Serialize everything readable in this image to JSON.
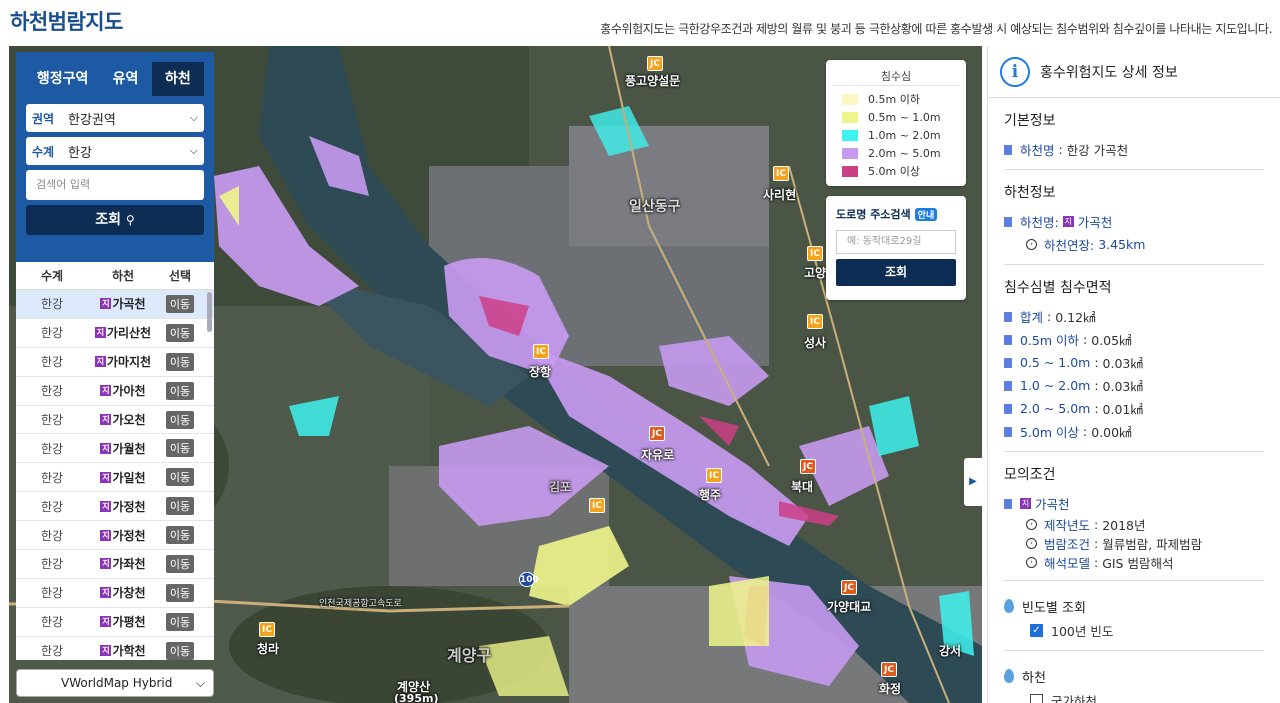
{
  "header": {
    "title": "하천범람지도",
    "description": "홍수위험지도는 극한강우조건과 제방의 월류 및 붕괴 등 극한상황에 따른 홍수발생 시 예상되는 침수범위와 침수깊이를 나타내는 지도입니다."
  },
  "left_panel": {
    "tabs": [
      {
        "label": "행정구역",
        "active": false
      },
      {
        "label": "유역",
        "active": false
      },
      {
        "label": "하천",
        "active": true
      }
    ],
    "basin_label": "권역",
    "basin_value": "한강권역",
    "system_label": "수계",
    "system_value": "한강",
    "search_placeholder": "검색어 입력",
    "query_button": "조회",
    "table_headers": {
      "system": "수계",
      "river": "하천",
      "select": "선택"
    },
    "move_label": "이동",
    "rivers": [
      {
        "system": "한강",
        "name": "가곡천",
        "selected": true
      },
      {
        "system": "한강",
        "name": "가리산천",
        "selected": false
      },
      {
        "system": "한강",
        "name": "가마지천",
        "selected": false
      },
      {
        "system": "한강",
        "name": "가아천",
        "selected": false
      },
      {
        "system": "한강",
        "name": "가오천",
        "selected": false
      },
      {
        "system": "한강",
        "name": "가월천",
        "selected": false
      },
      {
        "system": "한강",
        "name": "가일천",
        "selected": false
      },
      {
        "system": "한강",
        "name": "가정천",
        "selected": false
      },
      {
        "system": "한강",
        "name": "가정천",
        "selected": false
      },
      {
        "system": "한강",
        "name": "가좌천",
        "selected": false
      },
      {
        "system": "한강",
        "name": "가창천",
        "selected": false
      },
      {
        "system": "한강",
        "name": "가평천",
        "selected": false
      },
      {
        "system": "한강",
        "name": "가학천",
        "selected": false
      }
    ],
    "river_badge": "지",
    "basemap": "VWorldMap Hybrid"
  },
  "legend": {
    "title": "침수심",
    "items": [
      {
        "label": "0.5m 이하",
        "color": "#fbf6c2"
      },
      {
        "label": "0.5m ~ 1.0m",
        "color": "#eef58a"
      },
      {
        "label": "1.0m ~ 2.0m",
        "color": "#3ef2ef"
      },
      {
        "label": "2.0m ~ 5.0m",
        "color": "#c79af0"
      },
      {
        "label": "5.0m 이상",
        "color": "#cc3f86"
      }
    ]
  },
  "address_search": {
    "title": "도로명 주소검색",
    "guide": "안내",
    "placeholder": "예: 동작대로29길",
    "button": "조회"
  },
  "map_labels": {
    "goyang_seolmun": "풍고양설문",
    "sarihyeon": "사리현",
    "ilsan": "일산동구",
    "goyang": "고양",
    "seongsa": "성사",
    "jangang": "장항",
    "jayuro": "자유로",
    "haengju": "행주",
    "bukdae": "북대",
    "gimpo": "김포",
    "gayangdaegyo": "가양대교",
    "incheon_airport_expwy": "인천국제공항고속도로",
    "gyeyang_gu": "계양구",
    "gyeyangsan": "계양산",
    "gyeyangsan_height": "(395m)",
    "cheongna": "청라",
    "hwajeong": "화정",
    "gangseo": "강서",
    "jc": "JC",
    "ic": "IC",
    "route_100": "100"
  },
  "right_panel": {
    "title": "홍수위험지도 상세 정보",
    "basic_info": {
      "title": "기본정보",
      "river_name_label": "하천명",
      "river_name_value": "한강 가곡천"
    },
    "river_info": {
      "title": "하천정보",
      "river_name_label": "하천명:",
      "river_badge": "지",
      "river_name_value": "가곡천",
      "extension_label": "하천연장:",
      "extension_value": "3.45km"
    },
    "depth_area": {
      "title": "침수심별 침수면적",
      "rows": [
        {
          "label": "합계",
          "value": "0.12㎢"
        },
        {
          "label": "0.5m 이하",
          "value": "0.05㎢"
        },
        {
          "label": "0.5 ~ 1.0m",
          "value": "0.03㎢"
        },
        {
          "label": "1.0 ~ 2.0m",
          "value": "0.03㎢"
        },
        {
          "label": "2.0 ~ 5.0m",
          "value": "0.01㎢"
        },
        {
          "label": "5.0m 이상",
          "value": "0.00㎢"
        }
      ]
    },
    "simulation": {
      "title": "모의조건",
      "river_badge": "지",
      "river_name": "가곡천",
      "year_label": "제작년도",
      "year_value": "2018년",
      "flood_label": "범람조건",
      "flood_value": "월류범람, 파제범람",
      "model_label": "해석모델",
      "model_value": "GIS 범람해석"
    },
    "frequency": {
      "title": "빈도별 조회",
      "option": "100년 빈도",
      "checked": true
    },
    "river_section": {
      "title": "하천",
      "option": "국가하천"
    }
  }
}
